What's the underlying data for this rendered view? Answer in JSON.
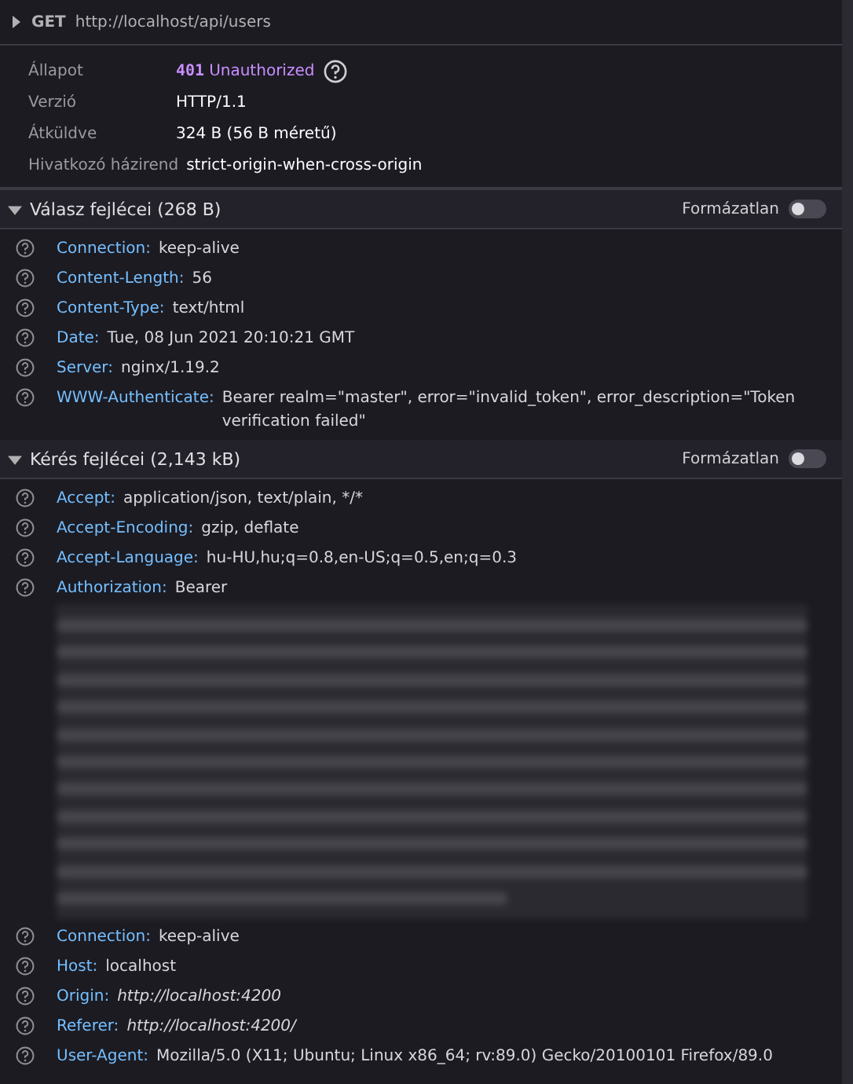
{
  "request": {
    "expanded": false,
    "method": "GET",
    "url": "http://localhost/api/users"
  },
  "summary": [
    {
      "label": "Állapot",
      "kind": "status",
      "code": "401",
      "value": "Unauthorized"
    },
    {
      "label": "Verzió",
      "kind": "text",
      "value": "HTTP/1.1"
    },
    {
      "label": "Átküldve",
      "kind": "text",
      "value": "324 B (56 B méretű)"
    },
    {
      "label": "Hivatkozó házirend",
      "kind": "text",
      "value": "strict-origin-when-cross-origin"
    }
  ],
  "sections": [
    {
      "title": "Válasz fejlécei (268 B)",
      "expanded": true,
      "toggle_label": "Formázatlan",
      "raw": false,
      "headers": [
        {
          "name": "Connection:",
          "value": "keep-alive",
          "kind": "text"
        },
        {
          "name": "Content-Length:",
          "value": "56",
          "kind": "text"
        },
        {
          "name": "Content-Type:",
          "value": "text/html",
          "kind": "text"
        },
        {
          "name": "Date:",
          "value": "Tue, 08 Jun 2021 20:10:21 GMT",
          "kind": "text"
        },
        {
          "name": "Server:",
          "value": "nginx/1.19.2",
          "kind": "text"
        },
        {
          "name": "WWW-Authenticate:",
          "value": "Bearer realm=\"master\", error=\"invalid_token\", error_description=\"Token verification failed\"",
          "kind": "text"
        }
      ]
    },
    {
      "title": "Kérés fejlécei (2,143 kB)",
      "expanded": true,
      "toggle_label": "Formázatlan",
      "raw": false,
      "headers": [
        {
          "name": "Accept:",
          "value": "application/json, text/plain, */*",
          "kind": "text"
        },
        {
          "name": "Accept-Encoding:",
          "value": "gzip, deflate",
          "kind": "text"
        },
        {
          "name": "Accept-Language:",
          "value": "hu-HU,hu;q=0.8,en-US;q=0.5,en;q=0.3",
          "kind": "text"
        },
        {
          "name": "Authorization:",
          "value": "Bearer",
          "kind": "redacted"
        },
        {
          "name": "Connection:",
          "value": "keep-alive",
          "kind": "text"
        },
        {
          "name": "Host:",
          "value": "localhost",
          "kind": "text"
        },
        {
          "name": "Origin:",
          "value": "http://localhost:4200",
          "kind": "italic"
        },
        {
          "name": "Referer:",
          "value": "http://localhost:4200/",
          "kind": "italic"
        },
        {
          "name": "User-Agent:",
          "value": "Mozilla/5.0 (X11; Ubuntu; Linux x86_64; rv:89.0) Gecko/20100101 Firefox/89.0",
          "kind": "text"
        }
      ]
    }
  ]
}
